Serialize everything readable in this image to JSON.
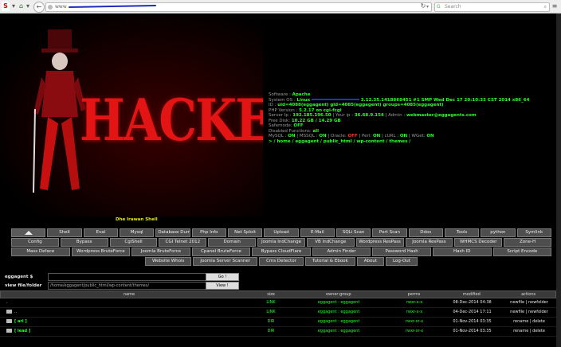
{
  "browser": {
    "url_prefix": "www",
    "search_placeholder": "Search"
  },
  "hero": {
    "word": "HACKED",
    "signature": "Dhe Irawan Shell"
  },
  "info": {
    "software_label": "Software :",
    "software": "Apache",
    "system_label": "System OS :",
    "system": "Linux",
    "system_rest": "3.12.35.1418868451 #1 SMP Wed Dec 17 20:10:33 CST 2014 x86_64",
    "id_label": "ID :",
    "id": "uid=4088(eggagent) gid=4085(eggagent) groups=4085(eggagent)",
    "php_label": "PHP Version :",
    "php": "5.2.17",
    "php_on": "on",
    "php_sapi": "cgi-fcgi",
    "server_ip_label": "Server Ip :",
    "server_ip": "192.185.196.50",
    "your_ip_label": "| Your ip :",
    "your_ip": "36.68.9.154",
    "admin_label": "| Admin :",
    "admin": "webmaster@eggagents.com",
    "free_disk_label": "Free Disk:",
    "free_disk": "10.22 GB / 14.29 GB",
    "safemode_label": "Safemode:",
    "safemode": "OFF",
    "disabled_label": "Disabled Functions:",
    "disabled": "all",
    "mysql_label": "MySQL :",
    "mysql": "ON",
    "mssql_label": "| MSSQL :",
    "mssql": "ON",
    "oracle_label": "| Oracle:",
    "oracle": "OFF",
    "perl_label": "| Perl:",
    "perl": "ON",
    "curl_label": "| cURL :",
    "curl": "ON",
    "wget_label": "| WGet:",
    "wget": "ON",
    "path": ">  / home / eggagent / public_html / wp-content / themes /"
  },
  "menu": {
    "row1": [
      "Shell",
      "Eval",
      "Mysql",
      "Database Dump",
      "Php Info",
      "Net Sploit",
      "Upload",
      "E-Mail",
      "SQLi Scan",
      "Port Scan",
      "Ddos",
      "Tools",
      "python",
      "Symlink"
    ],
    "row2": [
      "Config",
      "Bypass",
      "CgiShell",
      "CGI Telnet 2012",
      "Domain",
      "Joomla IndChange",
      "VB IndChange",
      "Wordpress ResPass",
      "Joomla ResPass",
      "WHMCS Decoder",
      "Zone-H"
    ],
    "row3": [
      "Mass Deface",
      "Wordpress BruteForce",
      "Joomla BruteForce",
      "Cpanel BruteForce",
      "Bypass CloudFlare",
      "Admin Finder",
      "Password Hash",
      "Hash ID",
      "Script Encode"
    ],
    "row4": [
      "Website Whois",
      "Joomla Server Scanner",
      "Cms Detector",
      "Tutorial & Ebook",
      "About",
      "Log-Out"
    ]
  },
  "forms": {
    "cmd_label": "eggagent $",
    "cmd_button": "Go !",
    "view_label": "view file/folder",
    "view_value": "/home/eggagent/public_html/wp-content/themes/",
    "view_button": "View !"
  },
  "table": {
    "headers": [
      "name",
      "size",
      "owner:group",
      "perms",
      "modified",
      "actions"
    ],
    "rows": [
      {
        "name": ".",
        "size": "LINK",
        "owner": "eggagent : eggagent",
        "perms": "rwxr-x-x",
        "modified": "08-Dec-2014 04:38",
        "actions": "newfile | newfolder"
      },
      {
        "name": "..",
        "size": "LINK",
        "owner": "eggagent : eggagent",
        "perms": "rwxr-x-x",
        "modified": "04-Dec-2014 17:11",
        "actions": "newfile | newfolder"
      },
      {
        "name": "[ ari ]",
        "size": "DIR",
        "owner": "eggagent : eggagent",
        "perms": "rwxr-xr-x",
        "modified": "01-Nov-2014 03:35",
        "actions": "rename | delete"
      },
      {
        "name": "[ lead ]",
        "size": "DIR",
        "owner": "eggagent : eggagent",
        "perms": "rwxr-xr-x",
        "modified": "01-Nov-2014 03:35",
        "actions": "rename | delete"
      }
    ]
  }
}
